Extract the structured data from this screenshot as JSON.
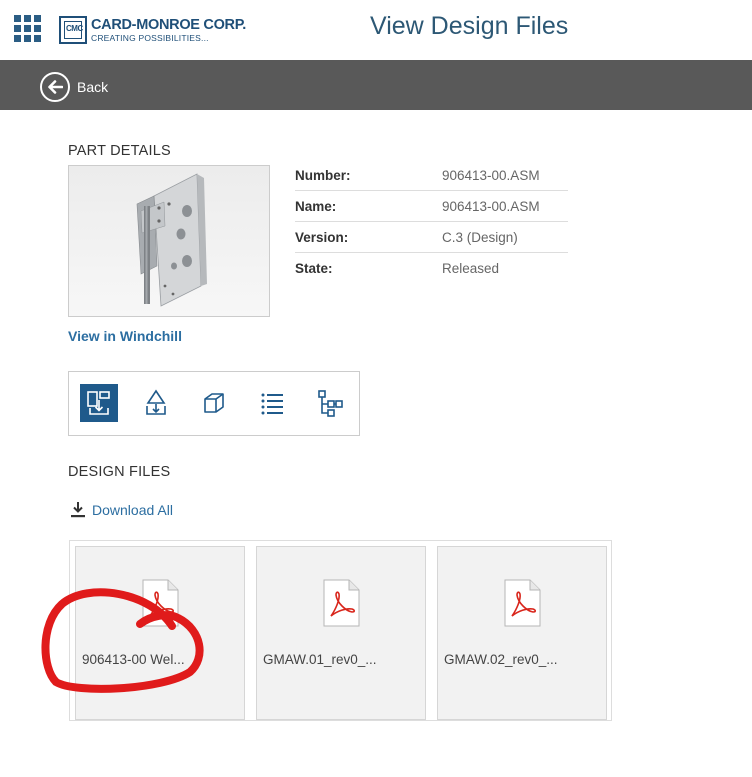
{
  "header": {
    "logo_name": "CARD-MONROE CORP.",
    "logo_tagline": "CREATING POSSIBILITIES...",
    "logo_mark": "CMC",
    "page_title": "View Design Files"
  },
  "nav": {
    "back_label": "Back"
  },
  "part_details": {
    "section_title": "PART DETAILS",
    "properties": [
      {
        "label": "Number:",
        "value": "906413-00.ASM"
      },
      {
        "label": "Name:",
        "value": "906413-00.ASM"
      },
      {
        "label": "Version:",
        "value": "C.3 (Design)"
      },
      {
        "label": "State:",
        "value": "Released"
      }
    ],
    "windchill_link": "View in Windchill"
  },
  "view_buttons": [
    {
      "icon": "design-files-icon",
      "active": true
    },
    {
      "icon": "drawing-download-icon",
      "active": false
    },
    {
      "icon": "3d-cube-icon",
      "active": false
    },
    {
      "icon": "list-icon",
      "active": false
    },
    {
      "icon": "structure-tree-icon",
      "active": false
    }
  ],
  "design_files": {
    "section_title": "DESIGN FILES",
    "download_all": "Download All",
    "files": [
      {
        "name": "906413-00 Wel...",
        "icon": "pdf-file-icon"
      },
      {
        "name": "GMAW.01_rev0_...",
        "icon": "pdf-file-icon"
      },
      {
        "name": "GMAW.02_rev0_...",
        "icon": "pdf-file-icon"
      }
    ]
  },
  "colors": {
    "brand": "#1f4f78",
    "navbar": "#595959",
    "link": "#2c6ea1",
    "active_button": "#1f5a8b",
    "annotation": "#e01b1b"
  }
}
